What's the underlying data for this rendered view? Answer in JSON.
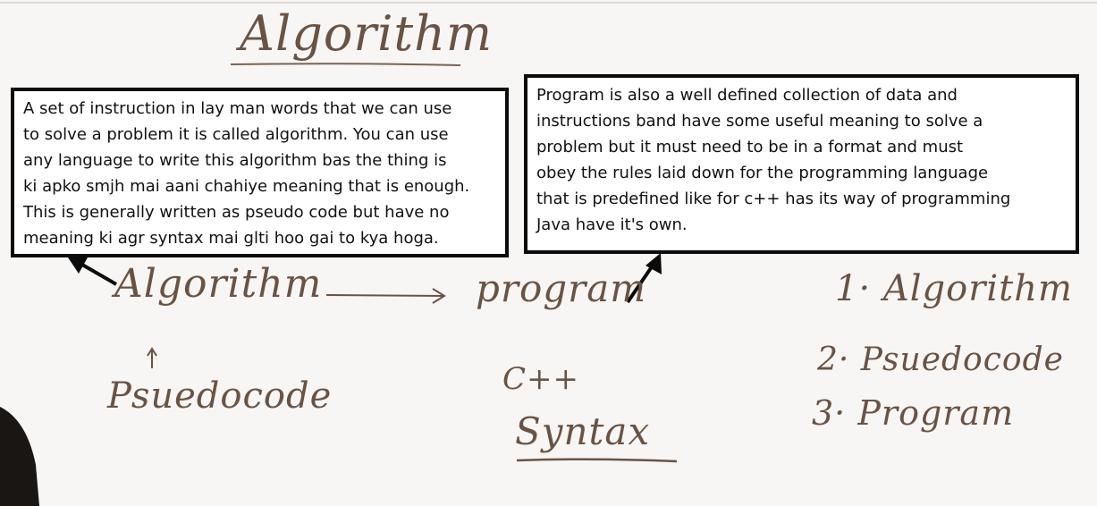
{
  "board": {
    "title": "Algorithm",
    "flow_from": "Algorithm",
    "flow_to": "program",
    "below_left": "Psuedocode",
    "below_center_top": "C++",
    "below_center_bottom": "Syntax",
    "list": [
      "1· Algorithm",
      "2· Psuedocode",
      "3· Program"
    ]
  },
  "callouts": {
    "left": "A set of instruction in lay man words that we can use\nto solve a problem it is called algorithm. You can use\nany language to write this algorithm bas the thing is\nki apko smjh mai aani chahiye meaning that is enough.\nThis is generally written as pseudo code but have no\nmeaning ki agr syntax mai glti hoo gai to kya hoga.",
    "right": "Program is also a well defined collection of data and\ninstructions band have some useful meaning to solve a\nproblem but it must need to be in  a format and must\nobey the rules laid down for the programming language\nthat is predefined like for c++ has its way of programming\nJava have it's own."
  },
  "colors": {
    "board": "#f7f6f4",
    "marker": "#6a5344",
    "callout_border": "#0b0b0b",
    "callout_fill": "#ffffff"
  }
}
